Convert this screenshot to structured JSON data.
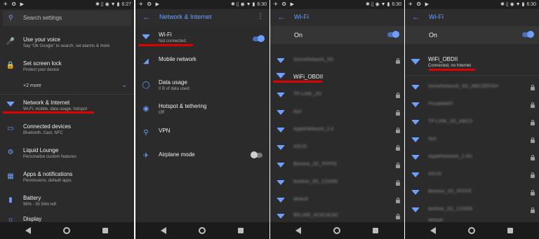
{
  "panel1": {
    "status": {
      "time": "6:27",
      "left_icons": "✈ ✪ ▶",
      "right_icons": "✱ ▯ ◉ ▼ ▮"
    },
    "search": {
      "placeholder": "Search settings"
    },
    "items": [
      {
        "title": "Use your voice",
        "subtitle": "Say \"Ok Google\" to search, set alarms & more",
        "icon": "mic-icon"
      },
      {
        "title": "Set screen lock",
        "subtitle": "Protect your device",
        "icon": "lock-icon"
      }
    ],
    "more": "+2 more",
    "settings": [
      {
        "title": "Network & Internet",
        "subtitle": "Wi-Fi, mobile, data usage, hotspot",
        "icon": "wifi-icon"
      },
      {
        "title": "Connected devices",
        "subtitle": "Bluetooth, Cast, NFC",
        "icon": "devices-icon"
      },
      {
        "title": "Liquid Lounge",
        "subtitle": "Personalize custom features",
        "icon": "gear-icon"
      },
      {
        "title": "Apps & notifications",
        "subtitle": "Permissions, default apps",
        "icon": "apps-icon"
      },
      {
        "title": "Battery",
        "subtitle": "96% - 5h 54m left",
        "icon": "battery-icon"
      },
      {
        "title": "Display",
        "subtitle": "",
        "icon": "display-icon"
      }
    ]
  },
  "panel2": {
    "status": {
      "time": "6:30",
      "left_icons": "✈ ✪ ▶",
      "right_icons": "✱ ▯ ◉ ▼ ▮"
    },
    "title": "Network & Internet",
    "items": [
      {
        "title": "Wi-Fi",
        "subtitle": "Not connected",
        "icon": "wifi-icon"
      },
      {
        "title": "Mobile network",
        "subtitle": "",
        "icon": "signal-icon"
      },
      {
        "title": "Data usage",
        "subtitle": "0 B of data used",
        "icon": "data-usage-icon"
      },
      {
        "title": "Hotspot & tethering",
        "subtitle": "Off",
        "icon": "hotspot-icon"
      },
      {
        "title": "VPN",
        "subtitle": "",
        "icon": "vpn-key-icon"
      },
      {
        "title": "Airplane mode",
        "subtitle": "",
        "icon": "airplane-icon"
      }
    ]
  },
  "panel3": {
    "status": {
      "time": "6:30",
      "left_icons": "✈ ✪ ▶",
      "right_icons": "✱ ▯ ◉ ▼ ▮"
    },
    "title": "Wi-Fi",
    "on_label": "On",
    "networks": [
      "SomeNetwork_5G",
      "WiFi_OBDII",
      "TP-LINK_2G",
      "Ayo",
      "AppleNetwork_2.4",
      "ASUS",
      "Beeline_2G_FFFFE",
      "beeline_2G_123456",
      "default",
      "BELINE_6C6C6C6C"
    ]
  },
  "panel4": {
    "status": {
      "time": "6:30",
      "left_icons": "✈ ✪ ▶",
      "right_icons": "✱ ▯ ◉ ▼ ▮"
    },
    "title": "Wi-Fi",
    "on_label": "On",
    "connected": {
      "name": "WiFi_OBDII",
      "status": "Connected, no Internet"
    },
    "networks": [
      "SomeNetwork_5G_ABCDEFGH",
      "PrivateWiFi",
      "TP-LINK_2G_ABCD",
      "Ayo",
      "AppleNetwork_2.4G",
      "ASUS",
      "Beeline_2G_FFFFE",
      "beeline_2G_123456",
      "default"
    ]
  },
  "colors": {
    "accent": "#6da0ff",
    "background": "#2b2b2b",
    "highlight": "#e00000"
  }
}
